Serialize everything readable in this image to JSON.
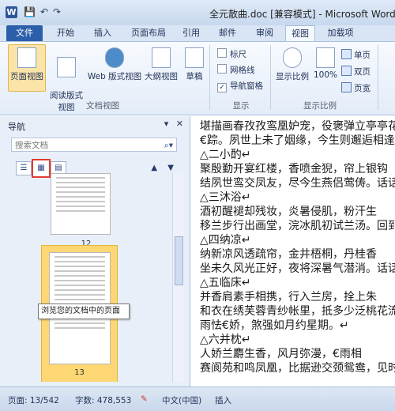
{
  "window": {
    "title": "全元散曲.doc [兼容模式] - Microsoft Word",
    "app_icon_letter": "W"
  },
  "quick_access": [
    "💾",
    "↶",
    "↷"
  ],
  "ribbon_tabs": [
    {
      "label": "文件"
    },
    {
      "label": "开始"
    },
    {
      "label": "插入"
    },
    {
      "label": "页面布局"
    },
    {
      "label": "引用"
    },
    {
      "label": "邮件"
    },
    {
      "label": "审阅"
    },
    {
      "label": "视图"
    },
    {
      "label": "加载项"
    }
  ],
  "ribbon": {
    "doc_views": {
      "buttons": [
        "页面视图",
        "阅读版式\n视图",
        "Web 版式视图",
        "大纲视图",
        "草稿"
      ],
      "group_label": "文档视图"
    },
    "show": {
      "items": [
        {
          "label": "标尺",
          "checked": false
        },
        {
          "label": "网格线",
          "checked": false
        },
        {
          "label": "导航窗格",
          "checked": true
        }
      ],
      "group_label": "显示"
    },
    "zoom": {
      "zoom_label": "显示比例",
      "zoom_100": "100%",
      "single_page": "单页",
      "two_pages": "双页",
      "page_width": "页宽",
      "group_label": "显示比例"
    }
  },
  "nav_pane": {
    "title": "导航",
    "search_placeholder": "搜索文档",
    "tooltip": "浏览您的文档中的页面",
    "page_numbers": [
      "12",
      "13"
    ]
  },
  "document": {
    "lines": [
      "堪描画春孜孜鸾凰妒宠，役褒弹立亭亭花",
      "€踪。夙世上未了姻缘，今生则邂逅相逢",
      "      △二小酌↵",
      "聚殷勤开宴红楼，香喷金猊，帘上银钩",
      "结夙世鸾交凤友，尽今生燕侣莺俦。话话",
      "      △三沐浴↵",
      "酒初醒褪却残妆，炎暑侵肌，粉汗生",
      "移兰步行出画堂，浣冰肌初试兰汤。回到",
      "      △四纳凉↵",
      "纳新凉风透疏帘，金井梧桐，丹桂香",
      "坐未久风光正好，夜将深暑气潜消。话话",
      "      △五临床↵",
      "并香肩素手相携，行入兰房，拴上朱",
      "和衣在绣芙蓉青纱帐里，抵多少泛桃花流",
      "雨怯€娇，煞强如月约星期。↵",
      "      △六并枕↵",
      "人娇兰麝生香，风月弥漫，€雨相",
      "赛阆苑和鸣凤凰，比据逊交颈鸳鸯，见时"
    ]
  },
  "status_bar": {
    "page": "页面: 13/542",
    "words": "字数: 478,553",
    "language": "中文(中国)",
    "mode": "插入"
  }
}
